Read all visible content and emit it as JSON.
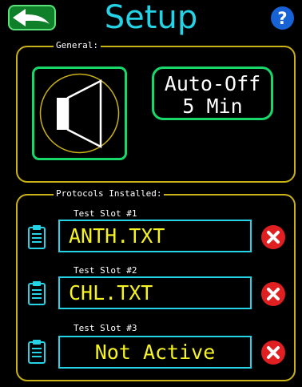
{
  "header": {
    "title": "Setup",
    "back_icon": "back-arrow-icon",
    "help_icon": "question-mark-icon"
  },
  "general": {
    "legend": "General:",
    "speaker_icon": "speaker-icon",
    "auto_off_line1": "Auto-Off",
    "auto_off_line2": "5 Min"
  },
  "protocols": {
    "legend": "Protocols Installed:",
    "slots": [
      {
        "label": "Test Slot #1",
        "value": "ANTH.TXT"
      },
      {
        "label": "Test Slot #2",
        "value": "CHL.TXT"
      },
      {
        "label": "Test Slot #3",
        "value": "Not Active"
      }
    ]
  },
  "colors": {
    "title": "#25d3e6",
    "group_border": "#c9b117",
    "button_border": "#18d86a",
    "slot_text": "#f6f325",
    "remove": "#e02020",
    "help": "#1763d6"
  }
}
